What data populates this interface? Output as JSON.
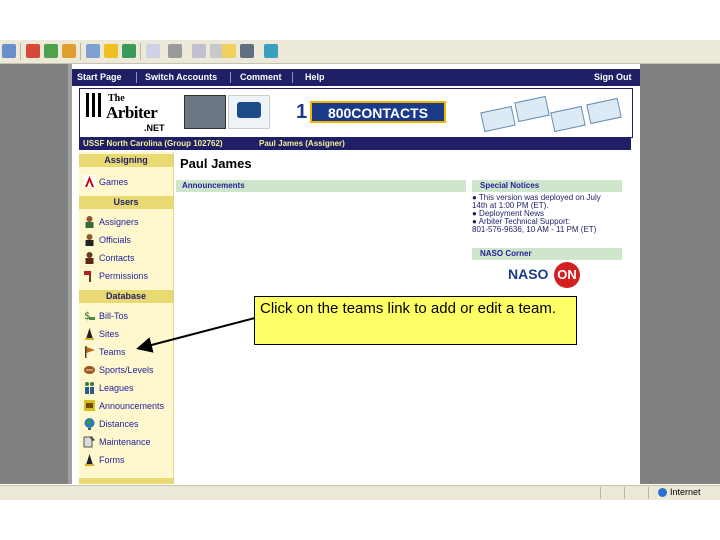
{
  "navbar": {
    "start_page": "Start Page",
    "switch_accounts": "Switch Accounts",
    "comment": "Comment",
    "help": "Help",
    "sign_out": "Sign Out"
  },
  "banner": {
    "logo_the": "The",
    "logo_arbiter_pre": "Arbiter",
    "logo_net": ".NET",
    "ad_1": "1",
    "ad_800": "800CONTACTS"
  },
  "subbar": {
    "group": "USSF North Carolina (Group 102762)",
    "user": "Paul James (Assigner)"
  },
  "sidebar": {
    "sections": [
      {
        "header": "Assigning",
        "items": [
          {
            "label": "Games",
            "icon": "arbiter-a-icon"
          }
        ]
      },
      {
        "header": "Users",
        "items": [
          {
            "label": "Assigners",
            "icon": "person-icon"
          },
          {
            "label": "Officials",
            "icon": "person-icon"
          },
          {
            "label": "Contacts",
            "icon": "person-icon"
          },
          {
            "label": "Permissions",
            "icon": "gavel-icon"
          }
        ]
      },
      {
        "header": "Database",
        "items": [
          {
            "label": "Bill-Tos",
            "icon": "money-icon"
          },
          {
            "label": "Sites",
            "icon": "cone-icon"
          },
          {
            "label": "Teams",
            "icon": "pennant-icon"
          },
          {
            "label": "Sports/Levels",
            "icon": "ball-icon"
          },
          {
            "label": "Leagues",
            "icon": "people-icon"
          },
          {
            "label": "Announcements",
            "icon": "megaphone-icon"
          },
          {
            "label": "Distances",
            "icon": "globe-icon"
          },
          {
            "label": "Maintenance",
            "icon": "wrench-icon"
          },
          {
            "label": "Forms",
            "icon": "cone-icon"
          }
        ]
      }
    ]
  },
  "main": {
    "user_name": "Paul James",
    "announcements_title": "Announcements",
    "special_notices_title": "Special Notices",
    "notices": [
      "●  This version was deployed on July",
      "14th at 1:00 PM (ET).",
      "●  Deployment News",
      "●  Arbiter Technical Support:",
      "801-576-9636, 10 AM - 11 PM (ET)"
    ],
    "naso_title": "NASO Corner",
    "naso_logo": "NASO",
    "naso_on": "ON"
  },
  "callout": {
    "text": "Click on the teams link to add or edit a team."
  },
  "statusbar": {
    "zone": "Internet"
  },
  "colors": {
    "nav_bg": "#1f1f66",
    "sidebar_bg": "#fff8cf",
    "section_header_bg": "#e9d972",
    "green_header": "#cfe6cc",
    "callout_bg": "#ffff66",
    "frame_gray": "#808080"
  }
}
